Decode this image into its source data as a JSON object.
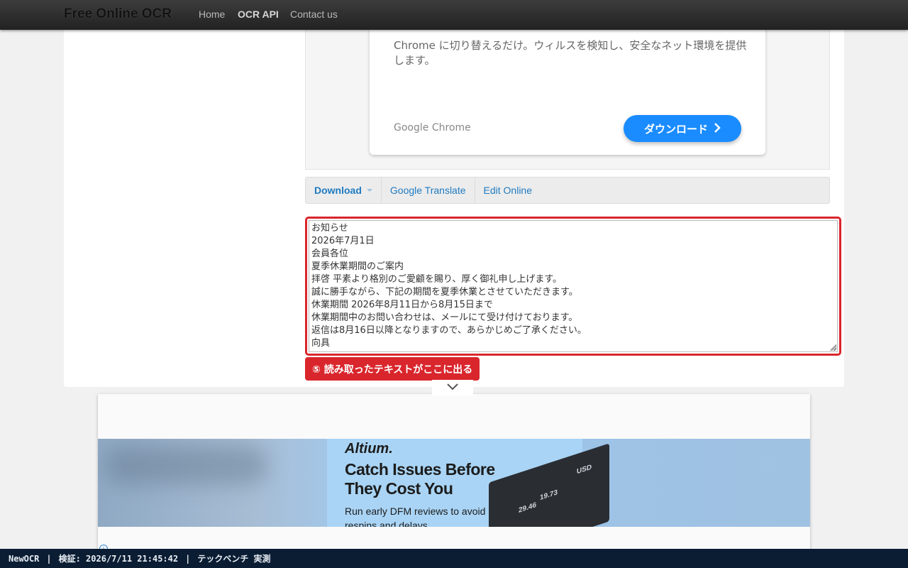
{
  "navbar": {
    "brand": "Free Online OCR",
    "links": [
      "Home",
      "OCR API",
      "Contact us"
    ]
  },
  "ad_card": {
    "description": "Chrome に切り替えるだけ。ウィルスを検知し、安全なネット環境を提供します。",
    "source": "Google Chrome",
    "button": "ダウンロード",
    "button_icon": "chevron-right-icon",
    "button_color": "#1a8cff"
  },
  "actions": {
    "download": "Download",
    "google_translate": "Google Translate",
    "edit_online": "Edit Online"
  },
  "result_lines": [
    "お知らせ",
    "2026年7月1日",
    "会員各位",
    "夏季休業期間のご案内",
    "拝啓 平素より格別のご愛顧を賜り、厚く御礼申し上げます。",
    "誠に勝手ながら、下記の期間を夏季休業とさせていただきます。",
    "休業期間 2026年8月11日から8月15日まで",
    "休業期間中のお問い合わせは、メールにて受け付けております。",
    "返信は8月16日以降となりますので、あらかじめご了承ください。",
    "向具"
  ],
  "callout": "⑤ 読み取ったテキストがここに出る",
  "highlight_color": "#d9262c",
  "lower_ad": {
    "brand": "Altium.",
    "headline": "Catch Issues Before They Cost You",
    "subtext": "Run early DFM reviews to avoid respins and delays.",
    "screen_values": [
      "29.46",
      "19.73",
      "USD"
    ]
  },
  "status_bar": {
    "app": "NewOCR",
    "verified": "検証: 2026/7/11 21:45:42",
    "note": "テックベンチ 実測"
  }
}
